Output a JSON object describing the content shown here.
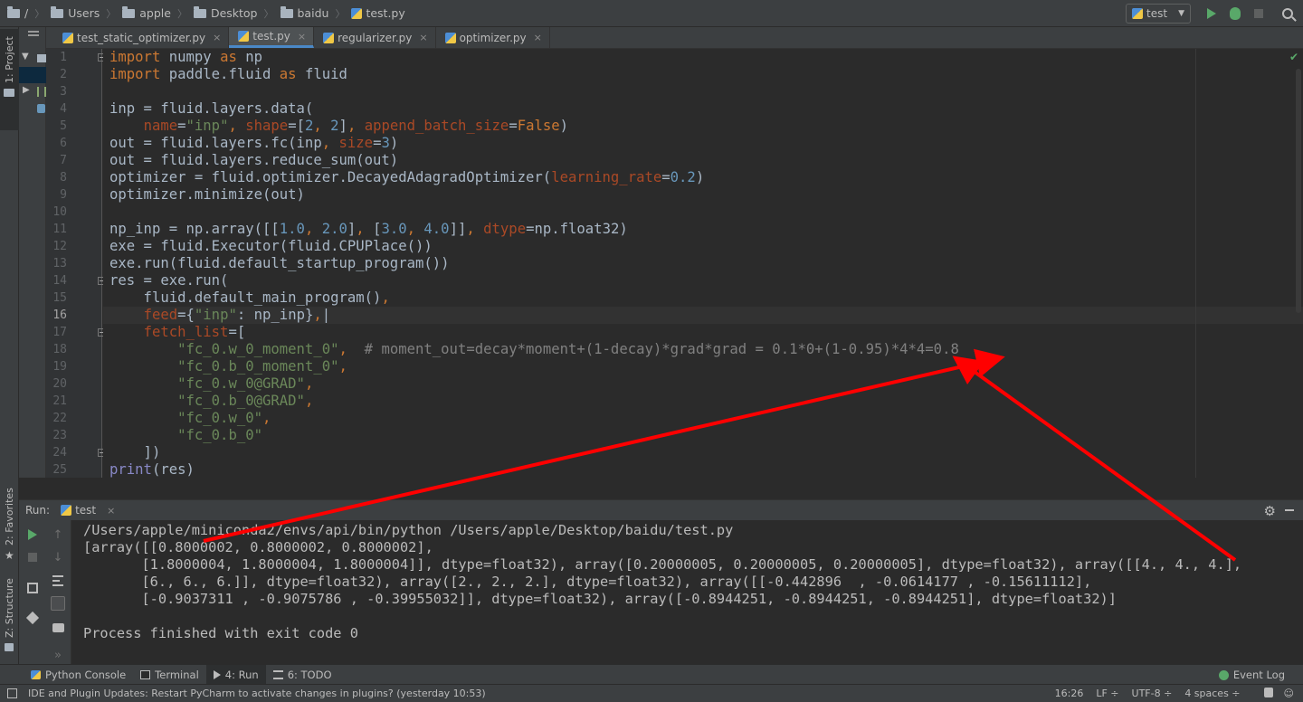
{
  "breadcrumbs": [
    "/",
    "Users",
    "apple",
    "Desktop",
    "baidu",
    "test.py"
  ],
  "toolbar": {
    "run_config": "test",
    "icons": [
      "run-icon",
      "debug-icon",
      "stop-icon",
      "search-icon"
    ]
  },
  "left_strip": {
    "project": "1: Project",
    "favorites": "2: Favorites",
    "structure": "Z: Structure"
  },
  "editor_tabs": [
    {
      "label": "test_static_optimizer.py",
      "close": "×",
      "active": false
    },
    {
      "label": "test.py",
      "close": "×",
      "active": true
    },
    {
      "label": "regularizer.py",
      "close": "×",
      "active": false
    },
    {
      "label": "optimizer.py",
      "close": "×",
      "active": false
    }
  ],
  "editor": {
    "current_line": 16,
    "line_numbers": [
      "1",
      "2",
      "3",
      "4",
      "5",
      "6",
      "7",
      "8",
      "9",
      "10",
      "11",
      "12",
      "13",
      "14",
      "15",
      "16",
      "17",
      "18",
      "19",
      "20",
      "21",
      "22",
      "23",
      "24",
      "25"
    ],
    "lines": [
      [
        {
          "t": "import",
          "c": "kw"
        },
        {
          "t": " numpy "
        },
        {
          "t": "as",
          "c": "kw"
        },
        {
          "t": " np"
        }
      ],
      [
        {
          "t": "import",
          "c": "kw"
        },
        {
          "t": " paddle.fluid "
        },
        {
          "t": "as",
          "c": "kw"
        },
        {
          "t": " fluid"
        }
      ],
      [],
      [
        {
          "t": "inp = fluid.layers.data("
        }
      ],
      [
        {
          "t": "    "
        },
        {
          "t": "name",
          "c": "param"
        },
        {
          "t": "="
        },
        {
          "t": "\"inp\"",
          "c": "str"
        },
        {
          "t": ", ",
          "c": "kw"
        },
        {
          "t": "shape",
          "c": "param"
        },
        {
          "t": "=["
        },
        {
          "t": "2",
          "c": "num"
        },
        {
          "t": ", ",
          "c": "kw"
        },
        {
          "t": "2",
          "c": "num"
        },
        {
          "t": "]"
        },
        {
          "t": ", ",
          "c": "kw"
        },
        {
          "t": "append_batch_size",
          "c": "param"
        },
        {
          "t": "="
        },
        {
          "t": "False",
          "c": "kw"
        },
        {
          "t": ")"
        }
      ],
      [
        {
          "t": "out = fluid.layers.fc(inp"
        },
        {
          "t": ", ",
          "c": "kw"
        },
        {
          "t": "size",
          "c": "param"
        },
        {
          "t": "="
        },
        {
          "t": "3",
          "c": "num"
        },
        {
          "t": ")"
        }
      ],
      [
        {
          "t": "out = fluid.layers.reduce_sum(out)"
        }
      ],
      [
        {
          "t": "optimizer = fluid.optimizer.DecayedAdagradOptimizer("
        },
        {
          "t": "learning_rate",
          "c": "param"
        },
        {
          "t": "="
        },
        {
          "t": "0.2",
          "c": "num"
        },
        {
          "t": ")"
        }
      ],
      [
        {
          "t": "optimizer.minimize(out)"
        }
      ],
      [],
      [
        {
          "t": "np_inp = np.array([["
        },
        {
          "t": "1.0",
          "c": "num"
        },
        {
          "t": ", ",
          "c": "kw"
        },
        {
          "t": "2.0",
          "c": "num"
        },
        {
          "t": "]"
        },
        {
          "t": ", ",
          "c": "kw"
        },
        {
          "t": "["
        },
        {
          "t": "3.0",
          "c": "num"
        },
        {
          "t": ", ",
          "c": "kw"
        },
        {
          "t": "4.0",
          "c": "num"
        },
        {
          "t": "]]"
        },
        {
          "t": ", ",
          "c": "kw"
        },
        {
          "t": "dtype",
          "c": "param"
        },
        {
          "t": "=np.float32)"
        }
      ],
      [
        {
          "t": "exe = fluid.Executor(fluid.CPUPlace())"
        }
      ],
      [
        {
          "t": "exe.run(fluid.default_startup_program())"
        }
      ],
      [
        {
          "t": "res = exe.run("
        }
      ],
      [
        {
          "t": "    fluid.default_main_program()"
        },
        {
          "t": ",",
          "c": "kw"
        }
      ],
      [
        {
          "t": "    "
        },
        {
          "t": "feed",
          "c": "param"
        },
        {
          "t": "={"
        },
        {
          "t": "\"inp\"",
          "c": "str"
        },
        {
          "t": ": np_inp}"
        },
        {
          "t": ",",
          "c": "kw"
        },
        {
          "t": "|"
        }
      ],
      [
        {
          "t": "    "
        },
        {
          "t": "fetch_list",
          "c": "param"
        },
        {
          "t": "=["
        }
      ],
      [
        {
          "t": "        "
        },
        {
          "t": "\"fc_0.w_0_moment_0\"",
          "c": "str"
        },
        {
          "t": ",",
          "c": "kw"
        },
        {
          "t": "  "
        },
        {
          "t": "# moment_out=decay*moment+(1-decay)*grad*grad = 0.1*0+(1-0.95)*4*4=0.8",
          "c": "cmt"
        }
      ],
      [
        {
          "t": "        "
        },
        {
          "t": "\"fc_0.b_0_moment_0\"",
          "c": "str"
        },
        {
          "t": ",",
          "c": "kw"
        }
      ],
      [
        {
          "t": "        "
        },
        {
          "t": "\"fc_0.w_0@GRAD\"",
          "c": "str"
        },
        {
          "t": ",",
          "c": "kw"
        }
      ],
      [
        {
          "t": "        "
        },
        {
          "t": "\"fc_0.b_0@GRAD\"",
          "c": "str"
        },
        {
          "t": ",",
          "c": "kw"
        }
      ],
      [
        {
          "t": "        "
        },
        {
          "t": "\"fc_0.w_0\"",
          "c": "str"
        },
        {
          "t": ",",
          "c": "kw"
        }
      ],
      [
        {
          "t": "        "
        },
        {
          "t": "\"fc_0.b_0\"",
          "c": "str"
        }
      ],
      [
        {
          "t": "    ])"
        }
      ],
      [
        {
          "t": "print",
          "c": "fn"
        },
        {
          "t": "(res)"
        }
      ]
    ]
  },
  "run_panel": {
    "label": "Run:",
    "tab": "test",
    "close": "×",
    "console": [
      "/Users/apple/miniconda2/envs/api/bin/python /Users/apple/Desktop/baidu/test.py",
      "[array([[0.8000002, 0.8000002, 0.8000002],",
      "       [1.8000004, 1.8000004, 1.8000004]], dtype=float32), array([0.20000005, 0.20000005, 0.20000005], dtype=float32), array([[4., 4., 4.],",
      "       [6., 6., 6.]], dtype=float32), array([2., 2., 2.], dtype=float32), array([[-0.442896  , -0.0614177 , -0.15611112],",
      "       [-0.9037311 , -0.9075786 , -0.39955032]], dtype=float32), array([-0.8944251, -0.8944251, -0.8944251], dtype=float32)]",
      "",
      "Process finished with exit code 0"
    ]
  },
  "tool_windows": [
    {
      "label": "Python Console",
      "icon": "python-icon",
      "active": false
    },
    {
      "label": "Terminal",
      "icon": "terminal-icon",
      "active": false
    },
    {
      "label": "4: Run",
      "icon": "run-icon",
      "active": true
    },
    {
      "label": "6: TODO",
      "icon": "todo-icon",
      "active": false
    }
  ],
  "event_log": "Event Log",
  "status": {
    "message": "IDE and Plugin Updates: Restart PyCharm to activate changes in plugins? (yesterday 10:53)",
    "position": "16:26",
    "line_sep": "LF ÷",
    "encoding": "UTF-8 ÷",
    "indent": "4 spaces ÷"
  },
  "colors": {
    "keyword": "#cc7832",
    "string": "#6a8759",
    "number": "#6897bb",
    "param": "#aa4926",
    "comment": "#808080",
    "annotation": "#ff0000",
    "run_green": "#59a869"
  }
}
